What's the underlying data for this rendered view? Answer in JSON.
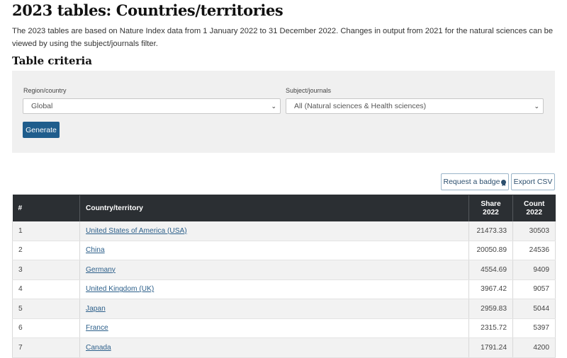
{
  "page": {
    "title": "2023 tables: Countries/territories",
    "intro": "The 2023 tables are based on Nature Index data from 1 January 2022 to 31 December 2022. Changes in output from 2021 for the natural sciences can be viewed by using the subject/journals filter."
  },
  "criteria": {
    "heading": "Table criteria",
    "region_label": "Region/country",
    "region_value": "Global",
    "subject_label": "Subject/journals",
    "subject_value": "All (Natural sciences & Health sciences)",
    "generate_label": "Generate"
  },
  "actions": {
    "badge_label": "Request a badge",
    "export_label": "Export CSV"
  },
  "table": {
    "headers": {
      "rank": "#",
      "country": "Country/territory",
      "share_line1": "Share",
      "share_line2": "2022",
      "count_line1": "Count",
      "count_line2": "2022"
    },
    "rows": [
      {
        "rank": "1",
        "country": "United States of America (USA)",
        "share": "21473.33",
        "count": "30503"
      },
      {
        "rank": "2",
        "country": "China",
        "share": "20050.89",
        "count": "24536"
      },
      {
        "rank": "3",
        "country": "Germany",
        "share": "4554.69",
        "count": "9409"
      },
      {
        "rank": "4",
        "country": "United Kingdom (UK)",
        "share": "3967.42",
        "count": "9057"
      },
      {
        "rank": "5",
        "country": "Japan",
        "share": "2959.83",
        "count": "5044"
      },
      {
        "rank": "6",
        "country": "France",
        "share": "2315.72",
        "count": "5397"
      },
      {
        "rank": "7",
        "country": "Canada",
        "share": "1791.24",
        "count": "4200"
      }
    ]
  },
  "colors": {
    "header_bg": "#2b2f33",
    "button_bg": "#1f5d8c",
    "link": "#2c5f8a"
  }
}
